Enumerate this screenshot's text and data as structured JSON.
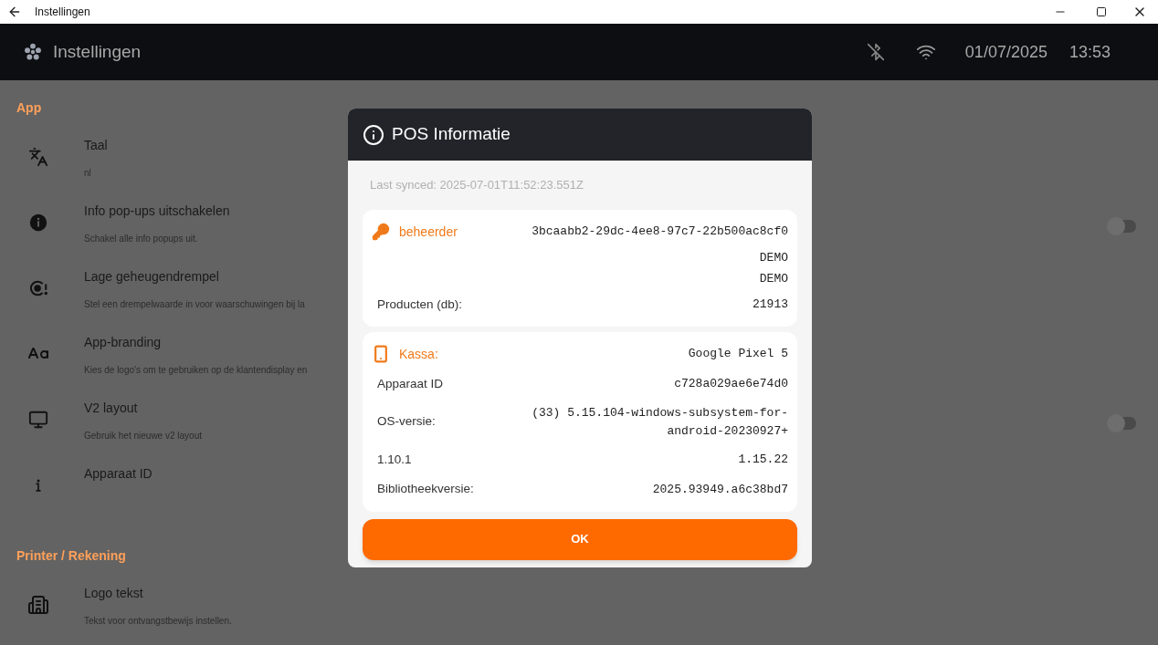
{
  "window": {
    "title": "Instellingen"
  },
  "app_bar": {
    "title": "Instellingen",
    "date": "01/07/2025",
    "time": "13:53"
  },
  "sections": [
    {
      "heading": "App",
      "items": [
        {
          "kind": "link",
          "title": "Taal",
          "subtitle": "nl"
        },
        {
          "kind": "toggle",
          "title": "Info pop-ups uitschakelen",
          "subtitle": "Schakel alle info popups uit.",
          "on": false
        },
        {
          "kind": "link",
          "title": "Lage geheugendrempel",
          "subtitle": "Stel een drempelwaarde in voor waarschuwingen bij la"
        },
        {
          "kind": "link",
          "title": "App-branding",
          "subtitle": "Kies de logo's om te gebruiken op de klantendisplay en"
        },
        {
          "kind": "toggle",
          "title": "V2 layout",
          "subtitle": "Gebruik het nieuwe v2 layout",
          "on": false
        },
        {
          "kind": "link",
          "title": "Apparaat ID"
        }
      ]
    },
    {
      "heading": "Printer / Rekening",
      "items": [
        {
          "kind": "link",
          "title": "Logo tekst",
          "subtitle": "Tekst voor ontvangstbewijs instellen."
        }
      ]
    }
  ],
  "dialog": {
    "title": "POS Informatie",
    "last_synced": "Last synced: 2025-07-01T11:52:23.551Z",
    "cards": [
      {
        "rows": [
          {
            "kind": "header",
            "label": "beheerder",
            "value": "3bcaabb2-29dc-4ee8-97c7-22b500ac8cf0"
          },
          {
            "kind": "value",
            "value": "DEMO"
          },
          {
            "kind": "value",
            "value": "DEMO"
          },
          {
            "kind": "plain",
            "label": "Producten (db):",
            "value": "21913"
          }
        ]
      },
      {
        "rows": [
          {
            "kind": "header",
            "label": "Kassa:",
            "value": "Google Pixel 5"
          },
          {
            "kind": "plain",
            "label": "Apparaat ID",
            "value": "c728a029ae6e74d0"
          },
          {
            "kind": "plain",
            "label": "OS-versie:",
            "value": "(33) 5.15.104-windows-subsystem-for-android-20230927+"
          },
          {
            "kind": "plain",
            "label": "1.10.1",
            "value": "1.15.22"
          },
          {
            "kind": "plain",
            "label": "Bibliotheekversie:",
            "value": "2025.93949.a6c38bd7"
          }
        ]
      }
    ],
    "button": "OK"
  }
}
